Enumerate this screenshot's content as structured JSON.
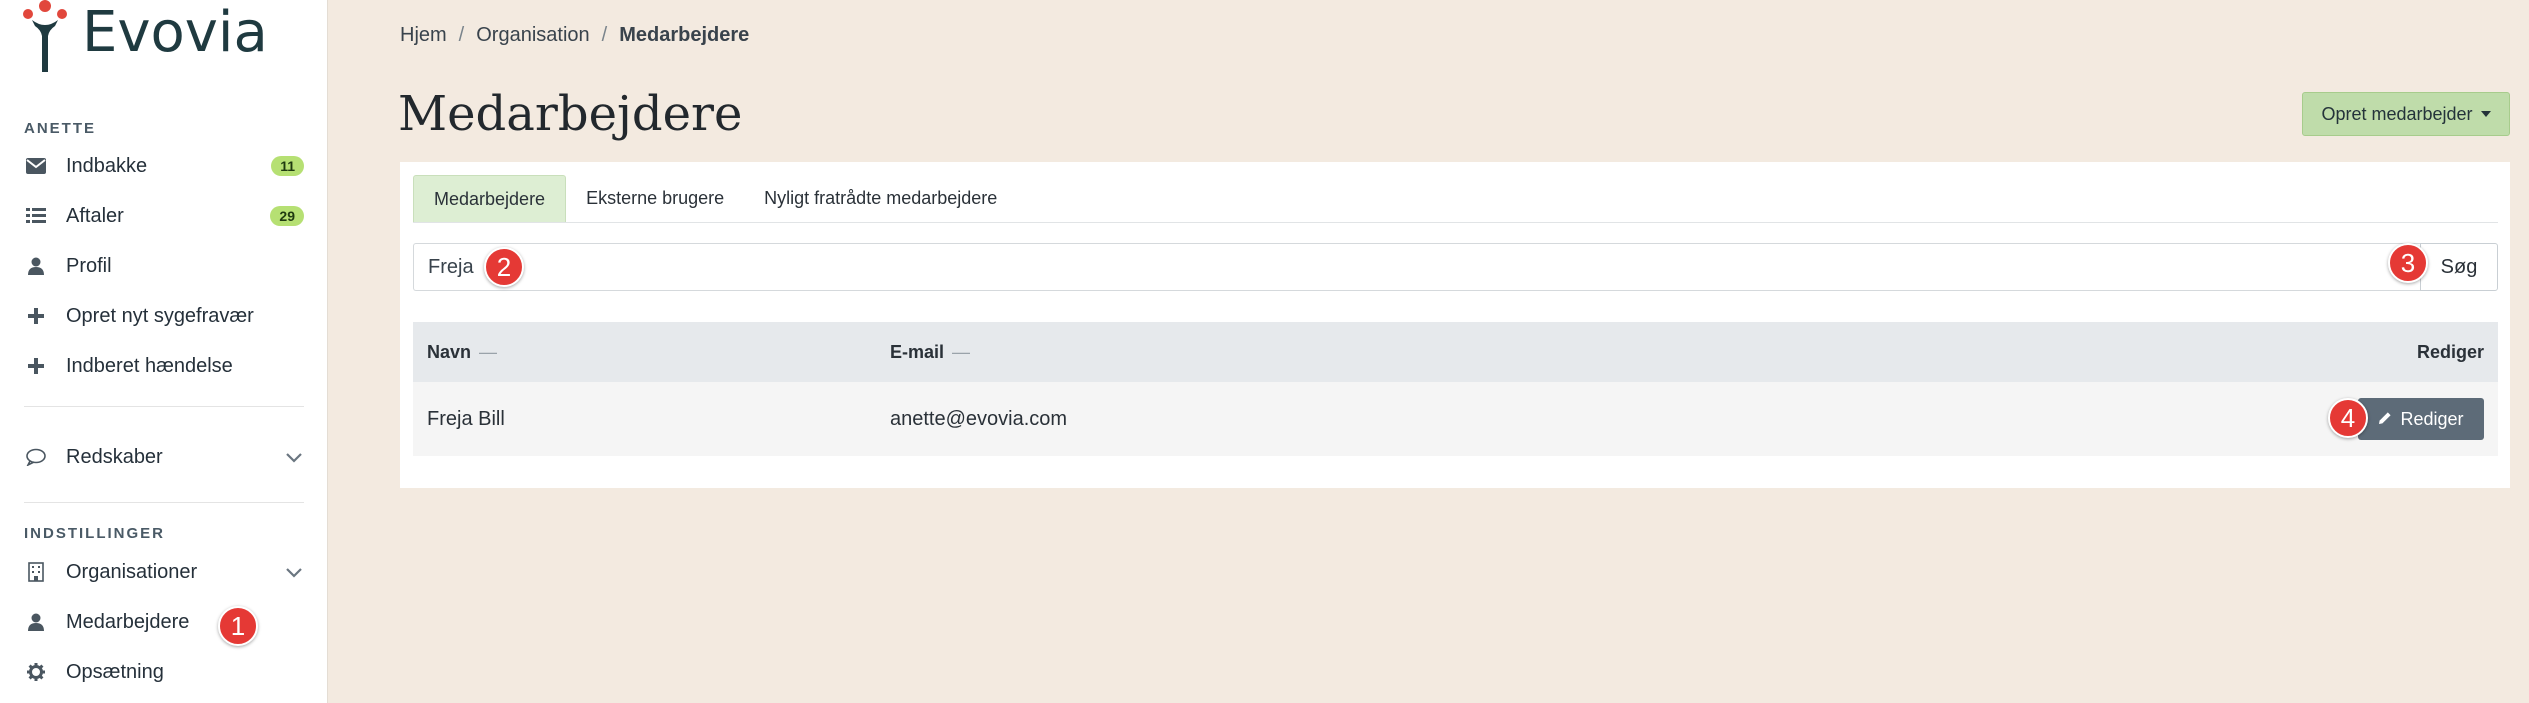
{
  "app": {
    "brand": "Evovia"
  },
  "sidebar": {
    "user_section": "ANETTE",
    "user_items": [
      {
        "label": "Indbakke",
        "icon": "envelope-icon",
        "badge": "11"
      },
      {
        "label": "Aftaler",
        "icon": "calendar-list-icon",
        "badge": "29"
      },
      {
        "label": "Profil",
        "icon": "user-icon"
      },
      {
        "label": "Opret nyt sygefravær",
        "icon": "plus-icon"
      },
      {
        "label": "Indberet hændelse",
        "icon": "plus-icon"
      }
    ],
    "tools": {
      "label": "Redskaber",
      "icon": "chat-bubble-icon"
    },
    "settings_section": "INDSTILLINGER",
    "settings_items": [
      {
        "label": "Organisationer",
        "icon": "building-icon"
      },
      {
        "label": "Medarbejdere",
        "icon": "user-icon"
      },
      {
        "label": "Opsætning",
        "icon": "gear-icon"
      }
    ]
  },
  "breadcrumb": {
    "items": [
      "Hjem",
      "Organisation"
    ],
    "separator": "/",
    "current": "Medarbejdere"
  },
  "page": {
    "title": "Medarbejdere",
    "create_button": "Opret medarbejder"
  },
  "tabs": [
    {
      "label": "Medarbejdere",
      "active": true
    },
    {
      "label": "Eksterne brugere",
      "active": false
    },
    {
      "label": "Nyligt fratrådte medarbejdere",
      "active": false
    }
  ],
  "search": {
    "value": "Freja",
    "button": "Søg"
  },
  "table": {
    "columns": {
      "name": "Navn",
      "email": "E-mail",
      "edit": "Rediger",
      "sort_indicator": "—"
    },
    "rows": [
      {
        "name": "Freja Bill",
        "email": "anette@evovia.com",
        "action": "Rediger"
      }
    ]
  },
  "markers": [
    "1",
    "2",
    "3",
    "4"
  ],
  "colors": {
    "background": "#f3eae0",
    "accent_green": "#bfdcaa",
    "badge_green": "#b6e073",
    "edit_button": "#5d6b78",
    "marker_red": "#e53935"
  }
}
